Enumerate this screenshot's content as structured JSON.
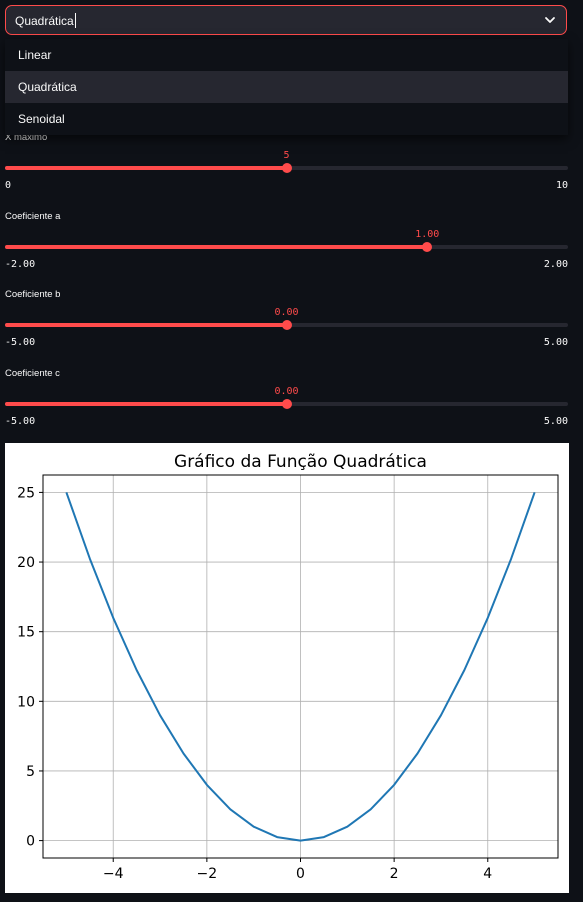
{
  "select": {
    "value": "Quadrática",
    "options": [
      "Linear",
      "Quadrática",
      "Senoidal"
    ],
    "selected_index": 1
  },
  "sliders": [
    {
      "label": "X máximo",
      "value": 5,
      "display": "5",
      "min": 0,
      "max": 10,
      "min_label": "0",
      "max_label": "10"
    },
    {
      "label": "Coeficiente a",
      "value": 1.0,
      "display": "1.00",
      "min": -2.0,
      "max": 2.0,
      "min_label": "-2.00",
      "max_label": "2.00"
    },
    {
      "label": "Coeficiente b",
      "value": 0.0,
      "display": "0.00",
      "min": -5.0,
      "max": 5.0,
      "min_label": "-5.00",
      "max_label": "5.00"
    },
    {
      "label": "Coeficiente c",
      "value": 0.0,
      "display": "0.00",
      "min": -5.0,
      "max": 5.0,
      "min_label": "-5.00",
      "max_label": "5.00"
    }
  ],
  "colors": {
    "accent": "#ff4b4b",
    "background": "#0e1117",
    "line": "#1f77b4"
  },
  "chart_data": {
    "type": "line",
    "title": "Gráfico da Função Quadrática",
    "xlabel": "",
    "ylabel": "",
    "xlim": [
      -5.5,
      5.5
    ],
    "ylim": [
      -1.25,
      26.25
    ],
    "xticks": [
      -4,
      -2,
      0,
      2,
      4
    ],
    "yticks": [
      0,
      5,
      10,
      15,
      20,
      25
    ],
    "grid": true,
    "x": [
      -5,
      -4.5,
      -4,
      -3.5,
      -3,
      -2.5,
      -2,
      -1.5,
      -1,
      -0.5,
      0,
      0.5,
      1,
      1.5,
      2,
      2.5,
      3,
      3.5,
      4,
      4.5,
      5
    ],
    "series": [
      {
        "values": [
          25,
          20.25,
          16,
          12.25,
          9,
          6.25,
          4,
          2.25,
          1,
          0.25,
          0,
          0.25,
          1,
          2.25,
          4,
          6.25,
          9,
          12.25,
          16,
          20.25,
          25
        ]
      }
    ]
  }
}
